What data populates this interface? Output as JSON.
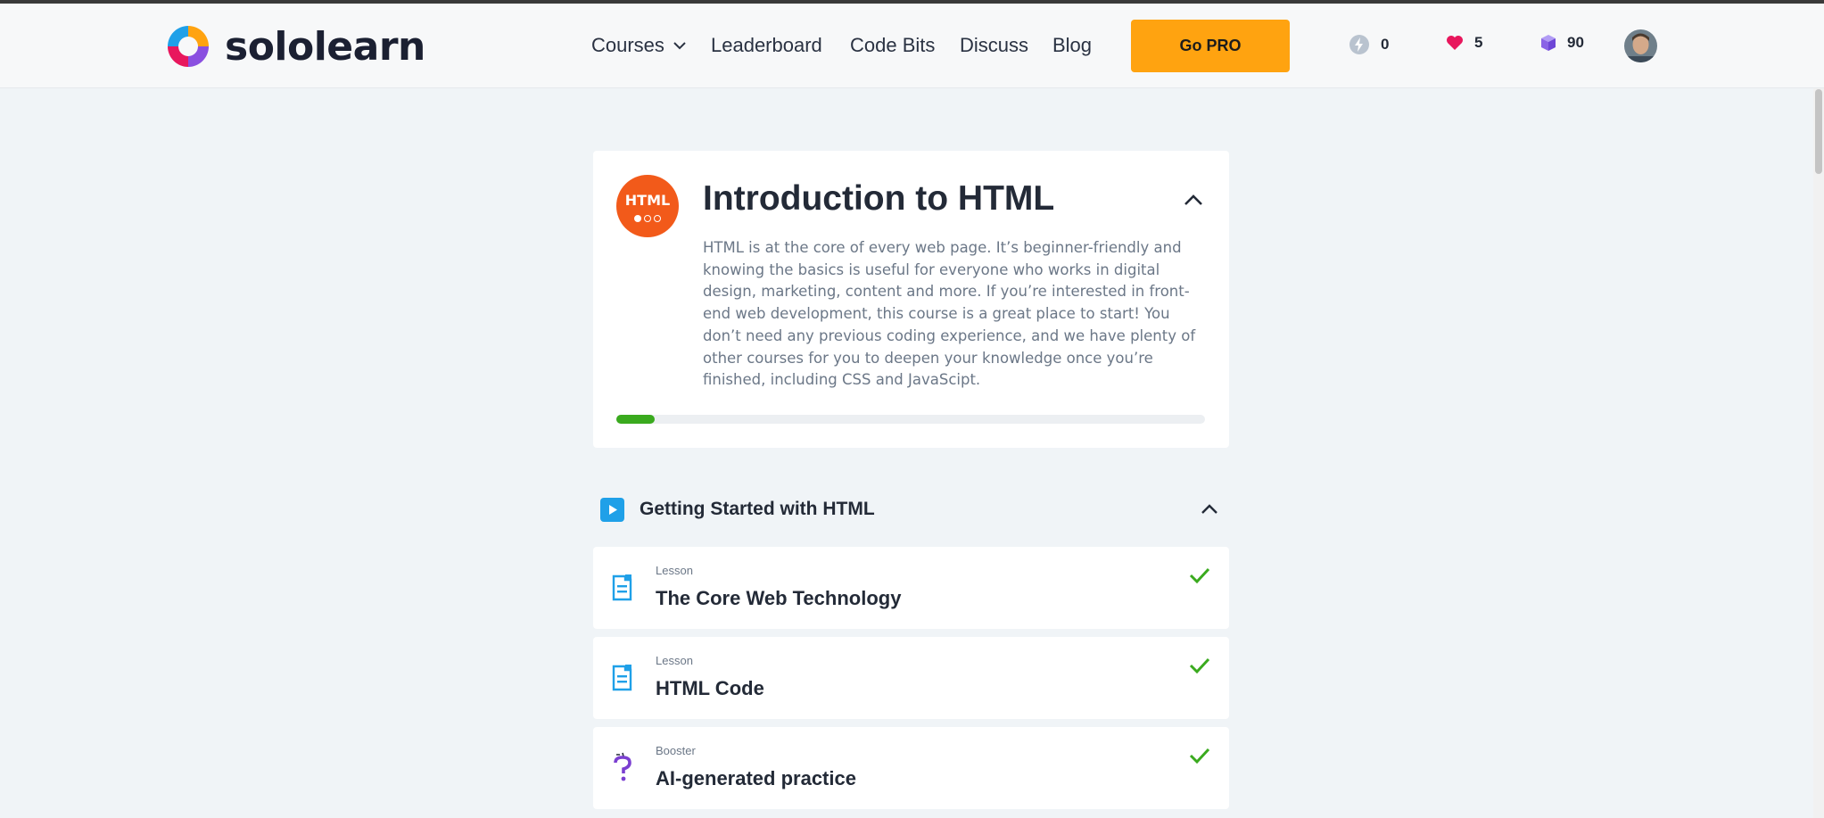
{
  "brand": {
    "name": "sololearn"
  },
  "nav": {
    "items": [
      "Courses",
      "Leaderboard",
      "Code Bits",
      "Discuss",
      "Blog"
    ],
    "go_pro_label": "Go PRO"
  },
  "stats": {
    "streak": "0",
    "hearts": "5",
    "gems": "90"
  },
  "course": {
    "badge_text": "HTML",
    "title": "Introduction to HTML",
    "description": "HTML is at the core of every web page. It’s beginner-friendly and knowing the basics is useful for everyone who works in digital design, marketing, content and more. If you’re interested in front-end web development, this course is a great place to start! You don’t need any previous coding experience, and we have plenty of other courses for you to deepen your knowledge once you’re finished, including CSS and JavaScipt.",
    "progress_fraction": 0.065
  },
  "module": {
    "title": "Getting Started with HTML"
  },
  "lessons": [
    {
      "type": "Lesson",
      "title": "The Core Web Technology",
      "icon": "lesson-doc-icon",
      "completed": true
    },
    {
      "type": "Lesson",
      "title": "HTML Code",
      "icon": "lesson-doc-icon",
      "completed": true
    },
    {
      "type": "Booster",
      "title": "AI-generated practice",
      "icon": "question-mark-icon",
      "completed": true
    }
  ],
  "colors": {
    "accent_orange": "#ffa310",
    "course_badge": "#f25a1a",
    "progress_green": "#3aaa1e",
    "lesson_blue": "#1fa0e8",
    "booster_purple": "#7b3fd1",
    "heart_pink": "#e8175d",
    "gem_purple": "#8a63e6"
  }
}
